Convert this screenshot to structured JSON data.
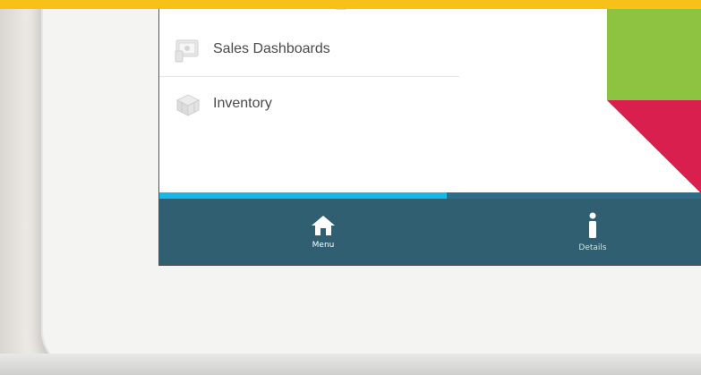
{
  "colors": {
    "accent_yellow": "#f8c11a",
    "tile_green": "#8dc340",
    "tile_red": "#d81f4e",
    "tabbar": "#2f5f70",
    "progress_track": "#2e6c87",
    "progress_fill": "#1bb5e8"
  },
  "menu": {
    "items": [
      {
        "label": "Sales Dashboards",
        "icon": "dashboard-icon"
      },
      {
        "label": "Inventory",
        "icon": "boxes-icon"
      }
    ]
  },
  "progress": {
    "value": 0.53
  },
  "tabbar": {
    "tabs": [
      {
        "label": "Menu",
        "icon": "home-icon"
      },
      {
        "label": "Details",
        "icon": "info-icon"
      }
    ]
  }
}
